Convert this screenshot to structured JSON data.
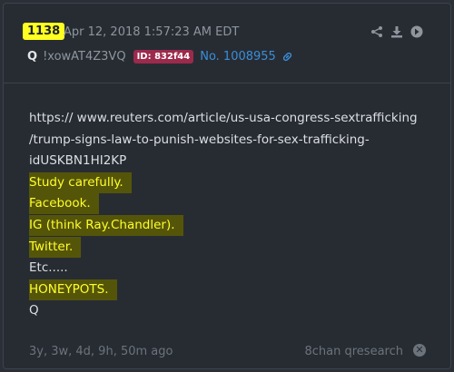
{
  "post": {
    "number": "1138",
    "date": "Apr 12, 2018 1:57:23 AM EDT",
    "name": "Q",
    "tripcode": "!xowAT4Z3VQ",
    "id_badge": "ID: 832f44",
    "post_no": "No. 1008955"
  },
  "header_icons": [
    "share-icon",
    "download-icon",
    "arrow-right-circle-icon"
  ],
  "body": {
    "lines": [
      {
        "text": "https:// www.reuters.com/article/us-usa-congress-sextrafficking",
        "highlight": false
      },
      {
        "text": "/trump-signs-law-to-punish-websites-for-sex-trafficking-",
        "highlight": false
      },
      {
        "text": "idUSKBN1HI2KP",
        "highlight": false
      },
      {
        "text": "Study carefully.",
        "highlight": true
      },
      {
        "text": "Facebook.",
        "highlight": true
      },
      {
        "text": "IG (think Ray.Chandler).",
        "highlight": true
      },
      {
        "text": "Twitter.",
        "highlight": true
      },
      {
        "text": "Etc.....",
        "highlight": false
      },
      {
        "text": "HONEYPOTS.",
        "highlight": true
      },
      {
        "text": "Q",
        "highlight": false
      }
    ]
  },
  "footer": {
    "age": "3y, 3w, 4d, 9h, 50m ago",
    "source": "8chan qresearch"
  },
  "colors": {
    "background": "#272c33",
    "highlight_bg": "#55550a",
    "highlight_text": "#ffff2a",
    "post_number_bg": "#ffff22",
    "id_badge_bg": "#9c2a4c",
    "link": "#3a8ed8"
  }
}
